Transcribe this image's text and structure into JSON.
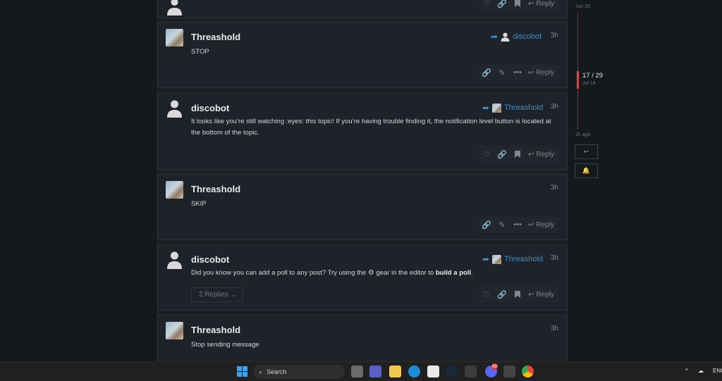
{
  "timeline": {
    "top_date": "Jun 28",
    "position": "17 / 29",
    "position_date": "Jul 14",
    "bottom_date": "1h ago"
  },
  "posts": [
    {
      "username": "Threashold",
      "reply_to": "discobot",
      "time": "3h",
      "body": "STOP",
      "reply_label": "Reply"
    },
    {
      "username": "discobot",
      "reply_to": "Threashold",
      "time": "3h",
      "body": "It looks like you’re still watching :eyes: this topic! If you’re having trouble finding it, the notification level button is located at the bottom of the topic.",
      "reply_label": "Reply"
    },
    {
      "username": "Threashold",
      "time": "3h",
      "body": "SKIP",
      "reply_label": "Reply"
    },
    {
      "username": "discobot",
      "reply_to": "Threashold",
      "time": "3h",
      "body_pre": "Did you know you can add a poll to any post? Try using the",
      "body_mid": "gear in the editor to",
      "body_bold": "build a poll",
      "body_post": ".",
      "replies_label": "2 Replies",
      "reply_label": "Reply"
    },
    {
      "username": "Threashold",
      "time": "3h",
      "body": "Stop sending message"
    }
  ],
  "top_partial": {
    "reply_label": "Reply"
  },
  "taskbar": {
    "search_label": "Search",
    "discord_badge": "99",
    "lang": "ENG"
  },
  "colors": {
    "accent_blue": "#3a8fd0",
    "timeline_red": "#e2453f",
    "background": "#15181d"
  }
}
